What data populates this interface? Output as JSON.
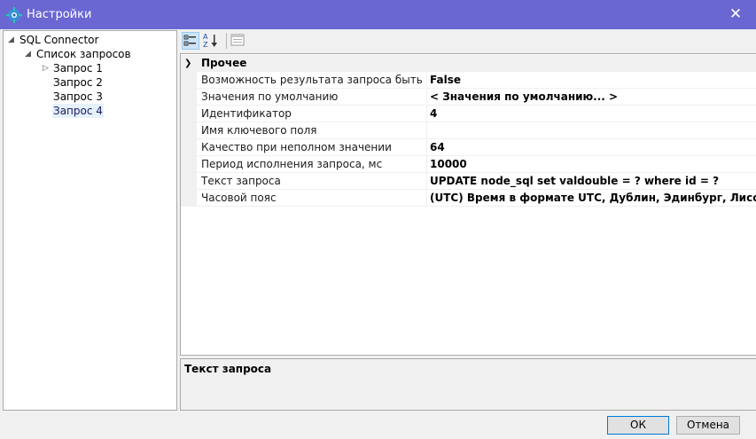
{
  "window": {
    "title": "Настройки"
  },
  "tree": {
    "root": "SQL Connector",
    "group": "Список запросов",
    "items": [
      {
        "label": "Запрос 1"
      },
      {
        "label": "Запрос 2"
      },
      {
        "label": "Запрос 3"
      },
      {
        "label": "Запрос 4"
      }
    ]
  },
  "grid": {
    "category": "Прочее",
    "properties": [
      {
        "name": "Возможность результата запроса быть пустым",
        "value": "False"
      },
      {
        "name": "Значения по умолчанию",
        "value": "< Значения по умолчанию... >"
      },
      {
        "name": "Идентификатор",
        "value": "4"
      },
      {
        "name": "Имя ключевого поля",
        "value": ""
      },
      {
        "name": "Качество при неполном значении",
        "value": "64"
      },
      {
        "name": "Период исполнения запроса, мс",
        "value": "10000"
      },
      {
        "name": "Текст запроса",
        "value": "UPDATE node_sql set valdouble = ? where id = ?"
      },
      {
        "name": "Часовой пояс",
        "value": "(UTC) Время в формате UTC, Дублин, Эдинбург, Лиссабон, Лондон"
      }
    ]
  },
  "description": {
    "title": "Текст запроса"
  },
  "buttons": {
    "ok": "ОК",
    "cancel": "Отмена"
  }
}
